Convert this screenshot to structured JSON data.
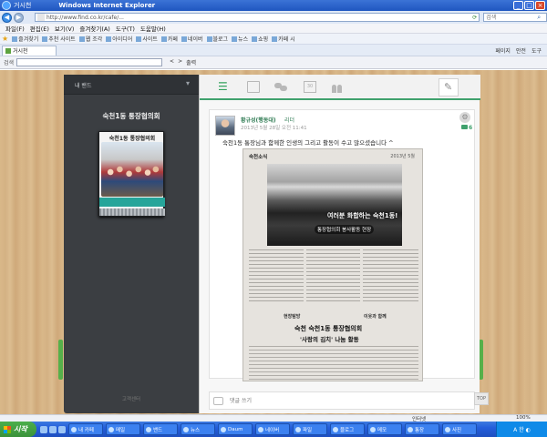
{
  "window": {
    "title_icon_text": "거시천",
    "title": "Windows Internet Explorer",
    "buttons": [
      "_",
      "□",
      "×"
    ]
  },
  "address_bar": {
    "url": "http://www.find.co.kr/cafe/...",
    "search_placeholder": "검색"
  },
  "menu": [
    "파일(F)",
    "편집(E)",
    "보기(V)",
    "즐겨찾기(A)",
    "도구(T)",
    "도움말(H)"
  ],
  "favorites": [
    "즐겨찾기",
    "추천 사이트",
    "웹 조각",
    "아이디어",
    "사이트",
    "카페",
    "네이버",
    "블로그",
    "뉴스",
    "쇼핑",
    "카페 시"
  ],
  "tab": {
    "label": "거시천"
  },
  "command_bar": [
    "페이지",
    "안전",
    "도구"
  ],
  "links_bar": {
    "label": "검색",
    "buttons": [
      "<",
      ">",
      "출력"
    ]
  },
  "left_panel": {
    "header_label": "내 밴드",
    "group_name": "숙천1동 통장협의회",
    "cover_title": "숙천1동 통장협의회",
    "footer": "고객센터"
  },
  "toolbar": {
    "icons": [
      "list-icon",
      "image-icon",
      "chat-icon",
      "calendar-icon",
      "members-icon"
    ],
    "calendar_label": "30"
  },
  "post": {
    "author": "황규성(행동대)",
    "rank": "리더",
    "meta": "2013년 5월 28일 오전 11:41",
    "comment_count": "6",
    "text": "숙천1동 통장님과 함께한 인생의 그리고 활동이 수고 많으셨습니다 ^",
    "clipping": {
      "masthead": "숙천소식",
      "masthead_right": "2013년 5월",
      "headline": "여러분 화합하는 숙천1동!",
      "subheadline": "통장협의회 봉사활동 현장",
      "section1": "현장탐방",
      "section2": "이웃과 함께",
      "article_title1": "숙천 숙천1동 통장협의회",
      "article_title2": "'사랑의 김치' 나눔 활동"
    }
  },
  "comment": {
    "placeholder": "댓글 쓰기"
  },
  "scroll_top": "TOP",
  "status": {
    "zone": "인터넷",
    "zoom": "100%"
  },
  "taskbar": {
    "start": "시작",
    "items": [
      "내 카페",
      "메일",
      "밴드",
      "뉴스",
      "Daum",
      "네이버",
      "파일",
      "블로그",
      "메모",
      "통장",
      "사진",
      "Band"
    ],
    "tray": "A 한 ◐"
  },
  "colors": {
    "accent": "#3fa16d",
    "dark_panel": "#3b3e42",
    "taskbar": "#245edb"
  }
}
